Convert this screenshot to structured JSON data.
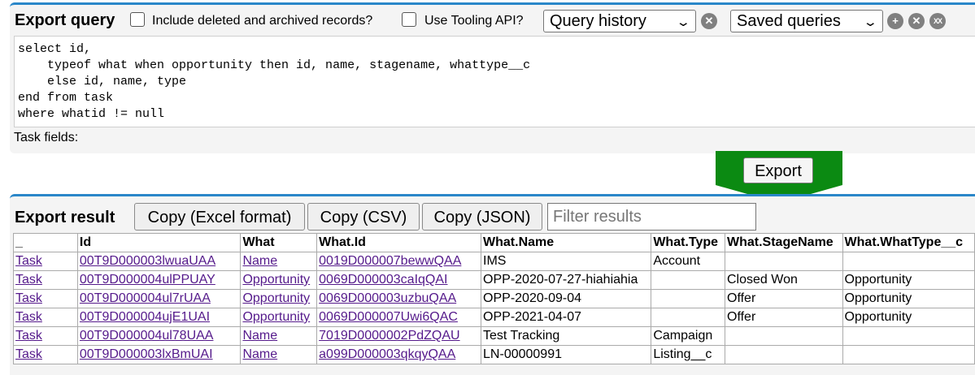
{
  "query_panel": {
    "title": "Export query",
    "include_deleted_label": "Include deleted and archived records?",
    "tooling_api_label": "Use Tooling API?",
    "query_history": "Query history",
    "saved_queries": "Saved queries",
    "clear_history_icon": "x-circle-icon",
    "save_query_icon": "plus-circle-icon",
    "clear_saved_icon": "x-circle-icon",
    "clear_all_saved_icon": "xx-circle-icon",
    "query_text": "select id,\n    typeof what when opportunity then id, name, stagename, whattype__c\n    else id, name, type\nend from task\nwhere whatid != null",
    "fields_label": "Task fields:"
  },
  "export_button_label": "Export",
  "colors": {
    "accent_blue": "#2a87c9",
    "export_green": "#0b8a12",
    "link_purple": "#551a8b"
  },
  "result_panel": {
    "title": "Export result",
    "copy_excel": "Copy (Excel format)",
    "copy_csv": "Copy (CSV)",
    "copy_json": "Copy (JSON)",
    "filter_placeholder": "Filter results"
  },
  "table": {
    "headers": [
      "_",
      "Id",
      "What",
      "What.Id",
      "What.Name",
      "What.Type",
      "What.StageName",
      "What.WhatType__c"
    ],
    "rows": [
      [
        "Task",
        "00T9D000003lwuaUAA",
        "Name",
        "0019D000007bewwQAA",
        "IMS",
        "Account",
        "",
        ""
      ],
      [
        "Task",
        "00T9D000004ulPPUAY",
        "Opportunity",
        "0069D000003caIqQAI",
        "OPP-2020-07-27-hiahiahia",
        "",
        "Closed Won",
        "Opportunity"
      ],
      [
        "Task",
        "00T9D000004ul7rUAA",
        "Opportunity",
        "0069D000003uzbuQAA",
        "OPP-2020-09-04",
        "",
        "Offer",
        "Opportunity"
      ],
      [
        "Task",
        "00T9D000004ujE1UAI",
        "Opportunity",
        "0069D000007Uwi6QAC",
        "OPP-2021-04-07",
        "",
        "Offer",
        "Opportunity"
      ],
      [
        "Task",
        "00T9D000004ul78UAA",
        "Name",
        "7019D0000002PdZQAU",
        "Test Tracking",
        "Campaign",
        "",
        ""
      ],
      [
        "Task",
        "00T9D000003lxBmUAI",
        "Name",
        "a099D000003qkqyQAA",
        "LN-00000991",
        "Listing__c",
        "",
        ""
      ]
    ]
  }
}
